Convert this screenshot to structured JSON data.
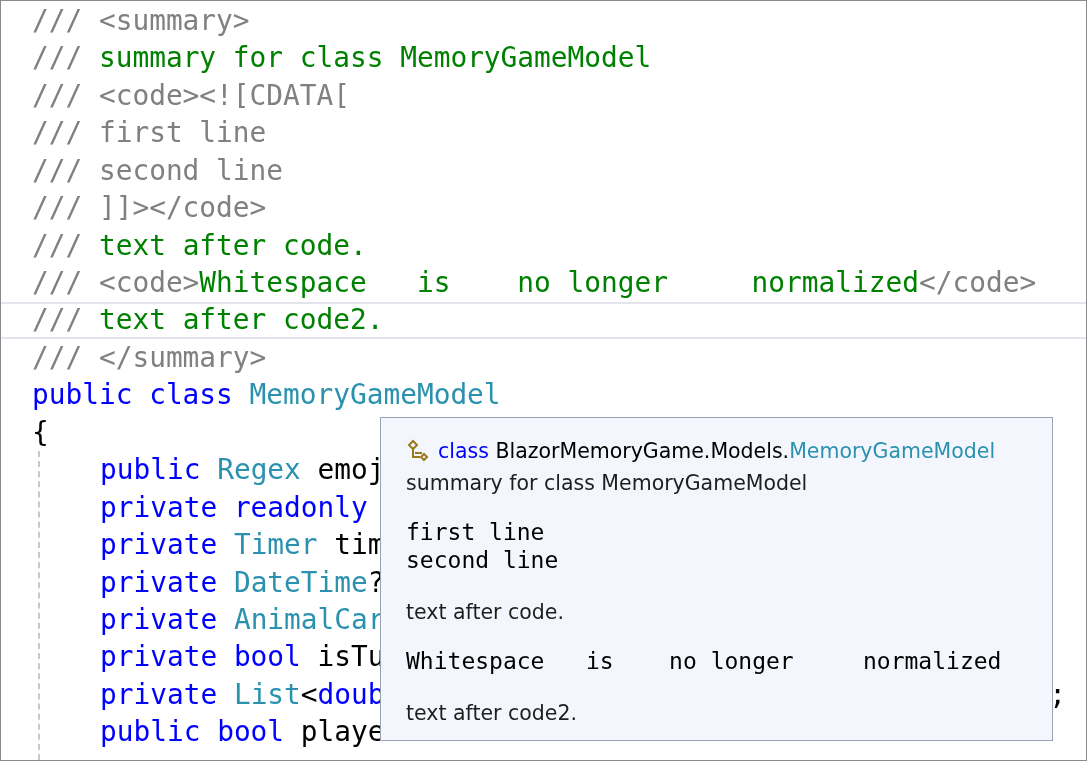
{
  "editor": {
    "lines": [
      {
        "current": false,
        "tokens": [
          {
            "kind": "delimiter",
            "text": "/// <summary>"
          }
        ]
      },
      {
        "current": false,
        "tokens": [
          {
            "kind": "delimiter",
            "text": "/// "
          },
          {
            "kind": "comment",
            "text": "summary for class MemoryGameModel"
          }
        ]
      },
      {
        "current": false,
        "tokens": [
          {
            "kind": "delimiter",
            "text": "/// <code><![CDATA["
          }
        ]
      },
      {
        "current": false,
        "tokens": [
          {
            "kind": "delimiter",
            "text": "/// first line"
          }
        ]
      },
      {
        "current": false,
        "tokens": [
          {
            "kind": "delimiter",
            "text": "/// second line"
          }
        ]
      },
      {
        "current": false,
        "tokens": [
          {
            "kind": "delimiter",
            "text": "/// ]]></code>"
          }
        ]
      },
      {
        "current": false,
        "tokens": [
          {
            "kind": "delimiter",
            "text": "/// "
          },
          {
            "kind": "comment",
            "text": "text after code."
          }
        ]
      },
      {
        "current": false,
        "tokens": [
          {
            "kind": "delimiter",
            "text": "/// <code>"
          },
          {
            "kind": "comment",
            "text": "Whitespace   is    no longer     normalized"
          },
          {
            "kind": "delimiter",
            "text": "</code>"
          }
        ]
      },
      {
        "current": true,
        "tokens": [
          {
            "kind": "delimiter",
            "text": "/// "
          },
          {
            "kind": "comment",
            "text": "text after code2."
          }
        ]
      },
      {
        "current": false,
        "tokens": [
          {
            "kind": "delimiter",
            "text": "/// </summary>"
          }
        ]
      },
      {
        "current": false,
        "tokens": [
          {
            "kind": "keyword",
            "text": "public class "
          },
          {
            "kind": "type",
            "text": "MemoryGameModel"
          }
        ]
      },
      {
        "current": false,
        "tokens": [
          {
            "kind": "plain",
            "text": "{"
          }
        ],
        "children": [
          {
            "current": false,
            "tokens": [
              {
                "kind": "keyword",
                "text": "public "
              },
              {
                "kind": "type",
                "text": "Regex"
              },
              {
                "kind": "plain",
                "text": " emoj"
              }
            ]
          },
          {
            "current": false,
            "tokens": [
              {
                "kind": "keyword",
                "text": "private readonly"
              }
            ]
          },
          {
            "current": false,
            "tokens": [
              {
                "kind": "keyword",
                "text": "private "
              },
              {
                "kind": "type",
                "text": "Timer"
              },
              {
                "kind": "plain",
                "text": " tim"
              }
            ]
          },
          {
            "current": false,
            "tokens": [
              {
                "kind": "keyword",
                "text": "private "
              },
              {
                "kind": "type",
                "text": "DateTime"
              },
              {
                "kind": "plain",
                "text": "?"
              }
            ]
          },
          {
            "current": false,
            "tokens": [
              {
                "kind": "keyword",
                "text": "private "
              },
              {
                "kind": "type",
                "text": "AnimalCar"
              }
            ]
          },
          {
            "current": false,
            "tokens": [
              {
                "kind": "keyword",
                "text": "private bool "
              },
              {
                "kind": "plain",
                "text": "isTu"
              }
            ]
          },
          {
            "current": false,
            "tokens": [
              {
                "kind": "keyword",
                "text": "private "
              },
              {
                "kind": "type",
                "text": "List"
              },
              {
                "kind": "plain",
                "text": "<"
              },
              {
                "kind": "keyword",
                "text": "doub"
              }
            ],
            "tail": ";"
          },
          {
            "current": false,
            "tokens": [
              {
                "kind": "keyword",
                "text": "public bool "
              },
              {
                "kind": "plain",
                "text": "playe"
              }
            ]
          }
        ]
      }
    ]
  },
  "quick_info": {
    "header": [
      {
        "kind": "keyword",
        "text": "class"
      },
      {
        "kind": "plain",
        "text": " BlazorMemoryGame.Models."
      },
      {
        "kind": "type",
        "text": "MemoryGameModel"
      }
    ],
    "sections": [
      {
        "kind": "text",
        "lines": [
          "summary for class MemoryGameModel"
        ]
      },
      {
        "kind": "code",
        "lines": [
          "first line",
          "second line"
        ]
      },
      {
        "kind": "text",
        "lines": [
          "text after code."
        ]
      },
      {
        "kind": "code",
        "lines": [
          "Whitespace   is    no longer     normalized"
        ]
      },
      {
        "kind": "text",
        "lines": [
          "text after code2."
        ]
      }
    ]
  }
}
